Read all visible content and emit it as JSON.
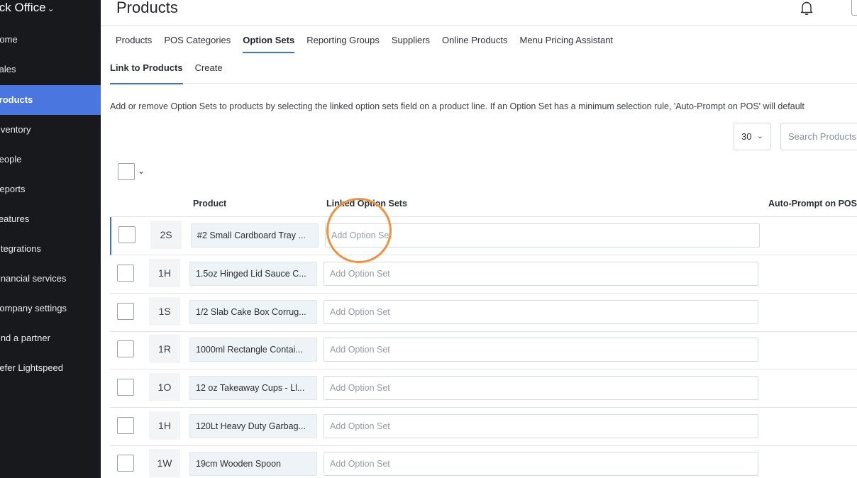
{
  "sidebar": {
    "title": "Back Office",
    "items": [
      {
        "label": "Home"
      },
      {
        "label": "Sales"
      },
      {
        "label": "Products"
      },
      {
        "label": "Inventory"
      },
      {
        "label": "People"
      },
      {
        "label": "Reports"
      },
      {
        "label": "Features"
      },
      {
        "label": "Integrations"
      },
      {
        "label": "Financial services"
      },
      {
        "label": "Company settings"
      },
      {
        "label": "Find a partner"
      },
      {
        "label": "Refer Lightspeed"
      }
    ],
    "active_index": 2
  },
  "header": {
    "title": "Products",
    "icons": [
      "bell-icon"
    ]
  },
  "tabs": [
    {
      "label": "Products"
    },
    {
      "label": "POS Categories"
    },
    {
      "label": "Option Sets"
    },
    {
      "label": "Reporting Groups"
    },
    {
      "label": "Suppliers"
    },
    {
      "label": "Online Products"
    },
    {
      "label": "Menu Pricing Assistant"
    }
  ],
  "active_tab": "Option Sets",
  "subtabs": [
    {
      "label": "Link to Products"
    },
    {
      "label": "Create"
    }
  ],
  "description": "Add or remove Option Sets to products by selecting the linked option sets field on a product line. If an Option Set has a minimum selection rule, 'Auto-Prompt on POS' will default",
  "controls": {
    "page_size": "30",
    "search_placeholder": "Search Products"
  },
  "table": {
    "columns": {
      "product": "Product",
      "linked": "Linked Option Sets",
      "auto_prompt": "Auto-Prompt on POS"
    },
    "option_placeholder": "Add Option Set",
    "rows": [
      {
        "abbr": "2S",
        "name": "#2 Small Cardboard Tray ..."
      },
      {
        "abbr": "1H",
        "name": "1.5oz Hinged Lid Sauce C..."
      },
      {
        "abbr": "1S",
        "name": "1/2 Slab Cake Box Corrug..."
      },
      {
        "abbr": "1R",
        "name": "1000ml Rectangle Contai..."
      },
      {
        "abbr": "1O",
        "name": "12 oz Takeaway Cups - Ll..."
      },
      {
        "abbr": "1H",
        "name": "120Lt Heavy Duty Garbag..."
      },
      {
        "abbr": "1W",
        "name": "19cm Wooden Spoon"
      }
    ]
  },
  "colors": {
    "sidebar_bg": "#17191d",
    "accent": "#4a76e0",
    "click_highlight": "#f0923c"
  }
}
